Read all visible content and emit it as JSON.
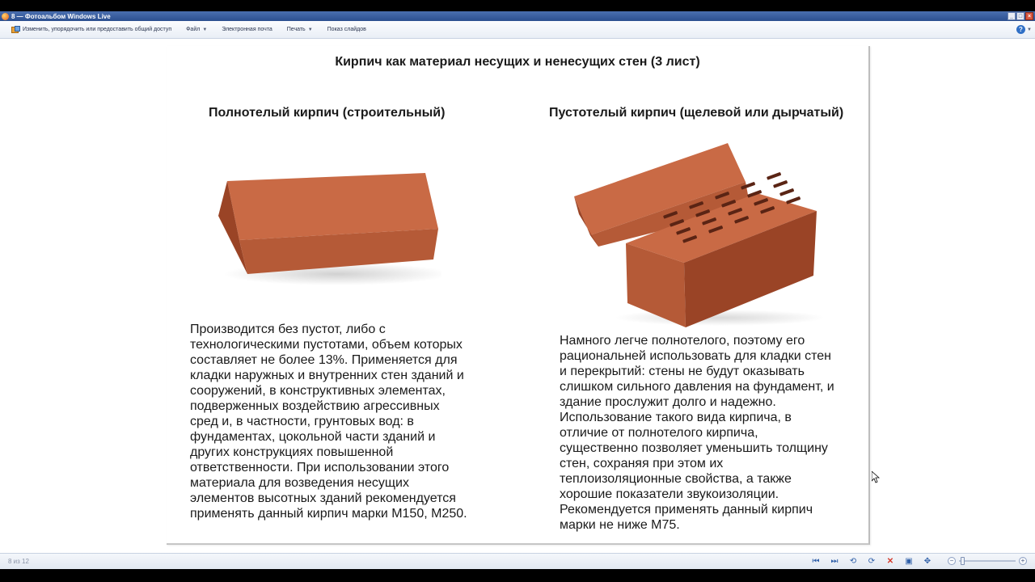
{
  "window": {
    "title": "8 — Фотоальбом Windows Live",
    "buttons": {
      "minimize": "_",
      "maximize": "□",
      "close": "×"
    }
  },
  "toolbar": {
    "share_label": "Изменить, упорядочить или предоставить общий доступ",
    "file_label": "Файл",
    "email_label": "Электронная почта",
    "print_label": "Печать",
    "slideshow_label": "Показ слайдов",
    "help_icon": "help-icon"
  },
  "slide": {
    "title": "Кирпич как материал несущих и ненесущих стен (3 лист)",
    "left": {
      "heading": "Полнотелый кирпич (строительный)",
      "text": "Производится без пустот, либо с\nтехнологическими пустотами, объем которых\nсоставляет не более 13%. Применяется для\nкладки наружных и внутренних стен зданий и\nсооружений, в конструктивных элементах,\nподверженных воздействию агрессивных\nсред и, в частности, грунтовых вод: в\nфундаментах, цокольной части зданий и\nдругих конструкциях повышенной\nответственности. При использовании этого\nматериала для возведения несущих\nэлементов высотных зданий рекомендуется\nприменять данный кирпич марки М150, М250."
    },
    "right": {
      "heading": "Пустотелый кирпич (щелевой или дырчатый)",
      "text": "Намного легче полнотелого, поэтому его\nрациональней использовать для кладки стен\nи перекрытий: стены не будут оказывать\nслишком сильного давления на фундамент, и\nздание прослужит долго и надежно.\nИспользование такого вида кирпича, в\nотличие от полнотелого кирпича,\nсущественно позволяет уменьшить толщину\nстен, сохраняя при этом их\nтеплоизоляционные свойства, а также\nхорошие показатели звукоизоляции.\nРекомендуется применять данный кирпич\nмарки не ниже М75."
    },
    "colors": {
      "brick_top": "#c96a45",
      "brick_front": "#b55a37",
      "brick_side": "#9a4426",
      "hole": "#5a2414"
    }
  },
  "status": {
    "pager": "8 из 12",
    "controls": {
      "first": "⏮",
      "next": "⏭",
      "rotate_left": "rotate-left-icon",
      "rotate_right": "rotate-right-icon",
      "delete": "✕",
      "slideshow": "slideshow-icon",
      "fit": "fit-icon"
    },
    "zoom_minus": "−",
    "zoom_plus": "+",
    "accent": "#2f5fa8"
  }
}
